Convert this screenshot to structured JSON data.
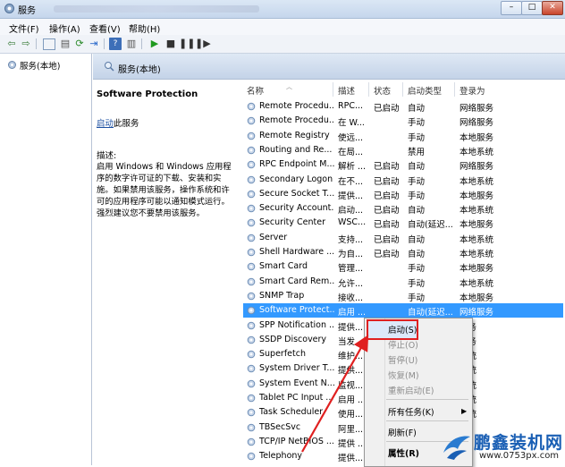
{
  "window": {
    "title": "服务"
  },
  "menu": [
    "文件(F)",
    "操作(A)",
    "查看(V)",
    "帮助(H)"
  ],
  "tree": {
    "item": "服务(本地)"
  },
  "header": {
    "title": "服务(本地)"
  },
  "detail": {
    "service_name": "Software Protection",
    "start_link": "启动",
    "start_suffix": "此服务",
    "desc_label": "描述:",
    "description": "启用 Windows 和 Windows 应用程序的数字许可证的下载、安装和实施。如果禁用该服务，操作系统和许可的应用程序可能以通知模式运行。强烈建议您不要禁用该服务。"
  },
  "columns": [
    "名称",
    "描述",
    "状态",
    "启动类型",
    "登录为"
  ],
  "rows": [
    {
      "name": "Remote Procedu...",
      "desc": "RPC...",
      "status": "已启动",
      "startup": "自动",
      "logon": "网络服务"
    },
    {
      "name": "Remote Procedu...",
      "desc": "在 W...",
      "status": "",
      "startup": "手动",
      "logon": "网络服务"
    },
    {
      "name": "Remote Registry",
      "desc": "使远...",
      "status": "",
      "startup": "手动",
      "logon": "本地服务"
    },
    {
      "name": "Routing and Re...",
      "desc": "在局...",
      "status": "",
      "startup": "禁用",
      "logon": "本地系统"
    },
    {
      "name": "RPC Endpoint M...",
      "desc": "解析 ...",
      "status": "已启动",
      "startup": "自动",
      "logon": "网络服务"
    },
    {
      "name": "Secondary Logon",
      "desc": "在不...",
      "status": "已启动",
      "startup": "手动",
      "logon": "本地系统"
    },
    {
      "name": "Secure Socket T...",
      "desc": "提供...",
      "status": "已启动",
      "startup": "手动",
      "logon": "本地服务"
    },
    {
      "name": "Security Account...",
      "desc": "启动...",
      "status": "已启动",
      "startup": "自动",
      "logon": "本地系统"
    },
    {
      "name": "Security Center",
      "desc": "WSC...",
      "status": "已启动",
      "startup": "自动(延迟...",
      "logon": "本地服务"
    },
    {
      "name": "Server",
      "desc": "支持...",
      "status": "已启动",
      "startup": "自动",
      "logon": "本地系统"
    },
    {
      "name": "Shell Hardware ...",
      "desc": "为自...",
      "status": "已启动",
      "startup": "自动",
      "logon": "本地系统"
    },
    {
      "name": "Smart Card",
      "desc": "管理...",
      "status": "",
      "startup": "手动",
      "logon": "本地服务"
    },
    {
      "name": "Smart Card Rem...",
      "desc": "允许...",
      "status": "",
      "startup": "手动",
      "logon": "本地系统"
    },
    {
      "name": "SNMP Trap",
      "desc": "接收...",
      "status": "",
      "startup": "手动",
      "logon": "本地服务"
    },
    {
      "name": "Software Protect...",
      "desc": "启用 ...",
      "status": "",
      "startup": "自动(延迟...",
      "logon": "网络服务"
    },
    {
      "name": "SPP Notification ...",
      "desc": "提供...",
      "status": "",
      "startup": "",
      "logon": "服务"
    },
    {
      "name": "SSDP Discovery",
      "desc": "当发...",
      "status": "",
      "startup": "",
      "logon": "服务"
    },
    {
      "name": "Superfetch",
      "desc": "维护...",
      "status": "",
      "startup": "",
      "logon": "系统"
    },
    {
      "name": "System Driver T...",
      "desc": "提供...",
      "status": "",
      "startup": "",
      "logon": "系统"
    },
    {
      "name": "System Event N...",
      "desc": "监视...",
      "status": "",
      "startup": "",
      "logon": "系统"
    },
    {
      "name": "Tablet PC Input ...",
      "desc": "启用 ...",
      "status": "",
      "startup": "",
      "logon": "系统"
    },
    {
      "name": "Task Scheduler",
      "desc": "使用...",
      "status": "",
      "startup": "",
      "logon": "系统"
    },
    {
      "name": "TBSecSvc",
      "desc": "阿里...",
      "status": "",
      "startup": "",
      "logon": ""
    },
    {
      "name": "TCP/IP NetBIOS ...",
      "desc": "提供 ...",
      "status": "",
      "startup": "",
      "logon": ""
    },
    {
      "name": "Telephony",
      "desc": "提供...",
      "status": "",
      "startup": "",
      "logon": ""
    }
  ],
  "context_menu": {
    "start": "启动(S)",
    "stop": "停止(O)",
    "pause": "暂停(U)",
    "resume": "恢复(M)",
    "restart": "重新启动(E)",
    "all_tasks": "所有任务(K)",
    "refresh": "刷新(F)",
    "properties": "属性(R)"
  },
  "watermark": {
    "brand": "鹏鑫装机网",
    "url": "www.0753px.com"
  },
  "colors": {
    "selection": "#3399ff",
    "highlight_box": "#e02020",
    "arrow": "#e02020",
    "link": "#1a4ea1"
  }
}
